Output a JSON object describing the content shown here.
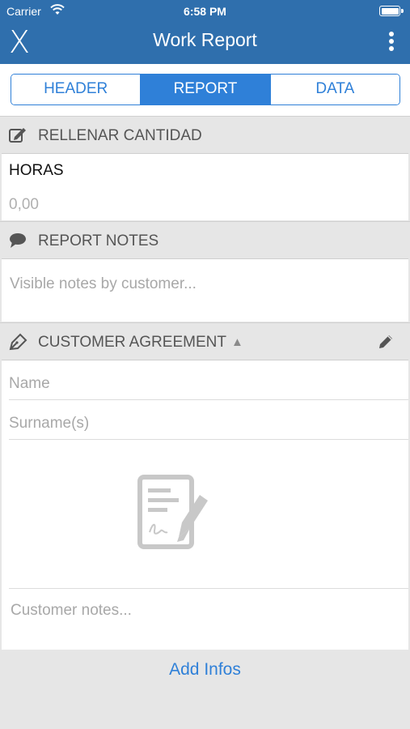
{
  "status_bar": {
    "carrier": "Carrier",
    "time": "6:58 PM",
    "icons": [
      "wifi-icon",
      "battery-icon"
    ]
  },
  "navbar": {
    "close_label": "X",
    "title": "Work Report",
    "menu_icon": "more-vertical-icon"
  },
  "tabs": {
    "items": [
      "HEADER",
      "REPORT",
      "DATA"
    ],
    "active": "REPORT"
  },
  "sections": {
    "quantity": {
      "title": "RELLENAR CANTIDAD",
      "icon": "edit-square-icon",
      "field_label": "HORAS",
      "field_placeholder": "0,00"
    },
    "notes": {
      "title": "REPORT NOTES",
      "icon": "speech-bubble-icon",
      "placeholder": "Visible notes by customer..."
    },
    "agreement": {
      "title": "CUSTOMER AGREEMENT",
      "icon": "pen-nib-icon",
      "indicator": "▲",
      "edit_icon": "pencil-icon",
      "name_placeholder": "Name",
      "surname_placeholder": "Surname(s)",
      "signature_icon": "signature-document-icon",
      "notes_placeholder": "Customer notes..."
    }
  },
  "footer": {
    "add_infos_label": "Add Infos"
  },
  "colors": {
    "nav_blue": "#2f6fad",
    "accent_blue": "#2f80d8",
    "background": "#e6e6e6"
  }
}
